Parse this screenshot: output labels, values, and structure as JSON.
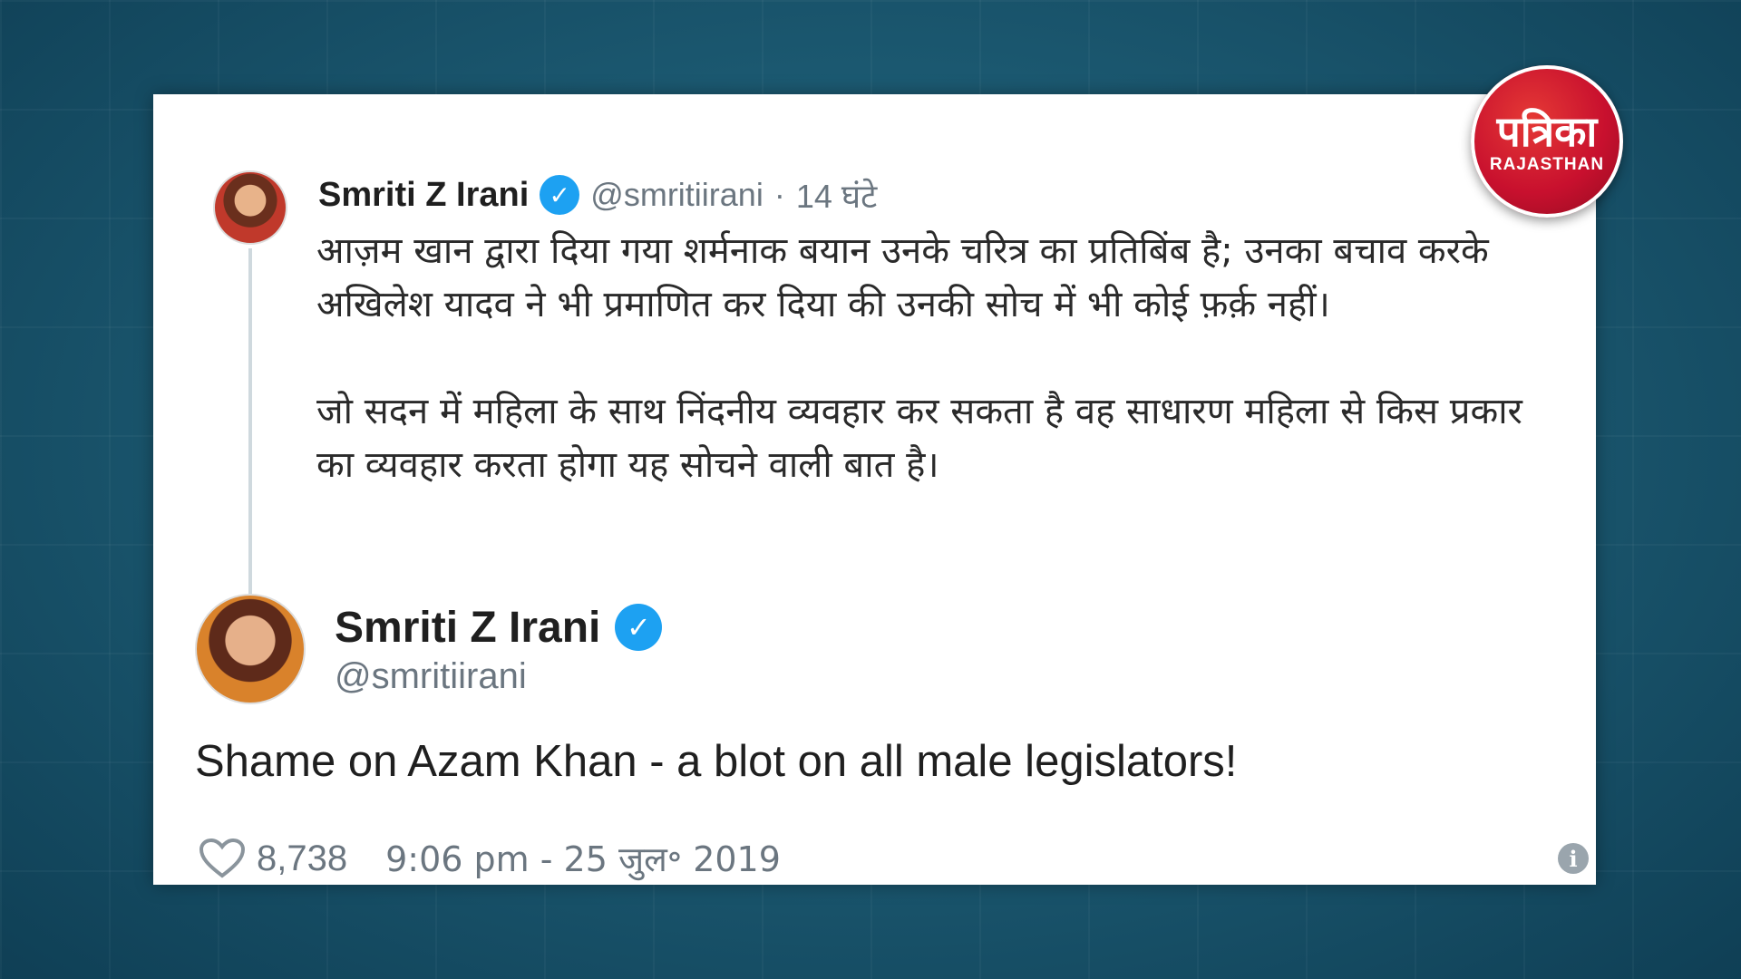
{
  "logo": {
    "main": "पत्रिका",
    "sub": "RAJASTHAN"
  },
  "quoted_tweet": {
    "name": "Smriti Z Irani",
    "handle": "@smritiirani",
    "separator": "·",
    "time": "14 घंटे",
    "paragraphs": [
      "आज़म खान द्वारा दिया गया शर्मनाक बयान उनके चरित्र का प्रतिबिंब है; उनका बचाव करके अखिलेश यादव ने भी प्रमाणित कर दिया की उनकी सोच में भी कोई फ़र्क़ नहीं।",
      "जो सदन में महिला के साथ निंदनीय व्यवहार कर सकता है वह साधारण महिला से किस प्रकार का व्यवहार करता होगा यह सोचने वाली बात है।"
    ]
  },
  "main_tweet": {
    "name": "Smriti Z Irani",
    "handle": "@smritiirani",
    "text": "Shame on Azam Khan - a blot on all male legislators!",
    "likes": "8,738",
    "timestamp": "9:06 pm - 25 जुल॰ 2019"
  },
  "icons": {
    "verified": "verified-badge-icon",
    "heart": "heart-icon",
    "info": "info-icon"
  },
  "colors": {
    "verified": "#1da1f2",
    "logo_red": "#c8102e",
    "background": "#1c5a72"
  }
}
